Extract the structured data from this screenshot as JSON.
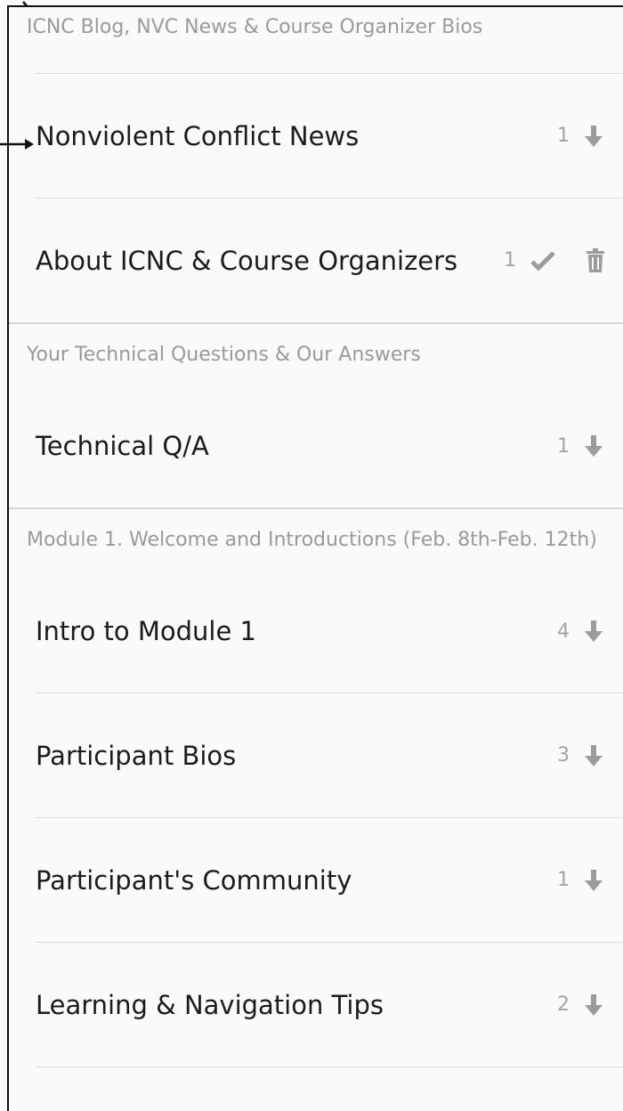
{
  "sections": [
    {
      "title": "ICNC Blog, NVC News & Course Organizer Bios",
      "rows": [
        {
          "label": "Nonviolent Conflict News",
          "count": "1",
          "icon": "arrow-down-icon"
        },
        {
          "label": "About ICNC & Course Organizers",
          "count": "1",
          "icon": "checkmark-icon",
          "extra_icon": "trash-icon"
        }
      ]
    },
    {
      "title": "Your Technical Questions & Our Answers",
      "rows": [
        {
          "label": "Technical Q/A",
          "count": "1",
          "icon": "arrow-down-icon"
        }
      ]
    },
    {
      "title": "Module 1. Welcome and Introductions (Feb. 8th-Feb. 12th)",
      "rows": [
        {
          "label": "Intro to Module 1",
          "count": "4",
          "icon": "arrow-down-icon"
        },
        {
          "label": "Participant Bios",
          "count": "3",
          "icon": "arrow-down-icon"
        },
        {
          "label": "Participant's Community",
          "count": "1",
          "icon": "arrow-down-icon"
        },
        {
          "label": "Learning & Navigation Tips",
          "count": "2",
          "icon": "arrow-down-icon"
        }
      ]
    }
  ],
  "colors": {
    "icon": "#9c9c9c",
    "annotation": "#111111"
  }
}
